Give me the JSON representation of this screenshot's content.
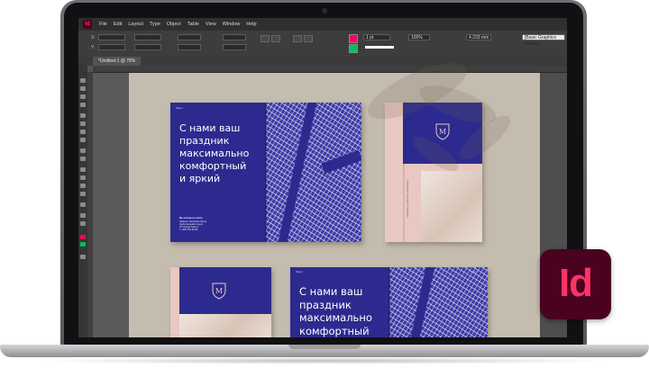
{
  "app": {
    "logo_text": "Id"
  },
  "menu": [
    "File",
    "Edit",
    "Layout",
    "Type",
    "Object",
    "Table",
    "View",
    "Window",
    "Help"
  ],
  "controlbar": {
    "stroke_weight": "1 pt",
    "zoom_percent": "100%",
    "size_value": "4.233 mm",
    "style_preset": "[Basic Graphics Frame]"
  },
  "document_tab": "*Untitled-1 @ 78%",
  "spreads": {
    "headline": "С нами ваш\nпраздник\nмаксимально\nкомфортный\nи яркий",
    "contact_title": "Мы всегда на связи",
    "contact_lines": [
      "Address: Del Prado Street",
      "Jardín Esquisito nuevo",
      "22 Orange Suite 2",
      "T +055 256 95 85"
    ],
    "spine_text": "Свадебные торжества на миллион",
    "folio_left": "Page 2",
    "folio_right": "Page 3",
    "crest_letter": "M"
  },
  "badge": {
    "text": "Id"
  },
  "colors": {
    "indesign_dark": "#49021f",
    "indesign_pink": "#ff3366",
    "brochure_blue": "#2d2a8f",
    "brochure_pink": "#e8c8c0"
  }
}
